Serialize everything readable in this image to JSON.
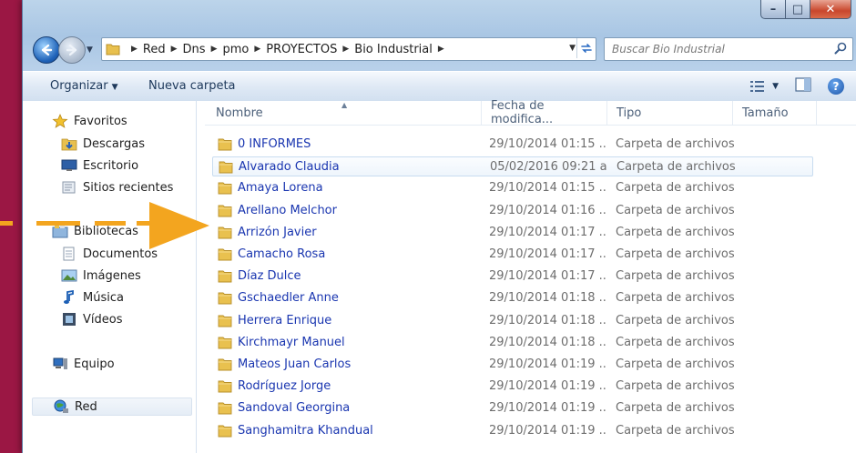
{
  "window": {
    "caption": {
      "min": "–",
      "max": "□",
      "close": "✕"
    }
  },
  "address": {
    "crumbs": [
      "Red",
      "Dns",
      "pmo",
      "PROYECTOS",
      "Bio Industrial"
    ]
  },
  "search": {
    "placeholder": "Buscar Bio Industrial"
  },
  "toolbar": {
    "organize": "Organizar",
    "new_folder": "Nueva carpeta"
  },
  "sidebar": {
    "favorites": "Favoritos",
    "downloads": "Descargas",
    "desktop": "Escritorio",
    "recent": "Sitios recientes",
    "libraries": "Bibliotecas",
    "documents": "Documentos",
    "images": "Imágenes",
    "music": "Música",
    "videos": "Vídeos",
    "computer": "Equipo",
    "network": "Red"
  },
  "columns": {
    "name": "Nombre",
    "date": "Fecha de modifica...",
    "type": "Tipo",
    "size": "Tamaño"
  },
  "files": [
    {
      "name": "0 INFORMES",
      "date": "29/10/2014 01:15 ...",
      "type": "Carpeta de archivos"
    },
    {
      "name": "Alvarado Claudia",
      "date": "05/02/2016 09:21 a...",
      "type": "Carpeta de archivos"
    },
    {
      "name": "Amaya Lorena",
      "date": "29/10/2014 01:15 ...",
      "type": "Carpeta de archivos"
    },
    {
      "name": "Arellano Melchor",
      "date": "29/10/2014 01:16 ...",
      "type": "Carpeta de archivos"
    },
    {
      "name": "Arrizón Javier",
      "date": "29/10/2014 01:17 ...",
      "type": "Carpeta de archivos"
    },
    {
      "name": "Camacho Rosa",
      "date": "29/10/2014 01:17 ...",
      "type": "Carpeta de archivos"
    },
    {
      "name": "Díaz Dulce",
      "date": "29/10/2014 01:17 ...",
      "type": "Carpeta de archivos"
    },
    {
      "name": "Gschaedler Anne",
      "date": "29/10/2014 01:18 ...",
      "type": "Carpeta de archivos"
    },
    {
      "name": "Herrera Enrique",
      "date": "29/10/2014 01:18 ...",
      "type": "Carpeta de archivos"
    },
    {
      "name": "Kirchmayr Manuel",
      "date": "29/10/2014 01:18 ...",
      "type": "Carpeta de archivos"
    },
    {
      "name": "Mateos Juan Carlos",
      "date": "29/10/2014 01:19 ...",
      "type": "Carpeta de archivos"
    },
    {
      "name": "Rodríguez Jorge",
      "date": "29/10/2014 01:19 ...",
      "type": "Carpeta de archivos"
    },
    {
      "name": "Sandoval Georgina",
      "date": "29/10/2014 01:19 ...",
      "type": "Carpeta de archivos"
    },
    {
      "name": "Sanghamitra Khandual",
      "date": "29/10/2014 01:19 ...",
      "type": "Carpeta de archivos"
    }
  ]
}
